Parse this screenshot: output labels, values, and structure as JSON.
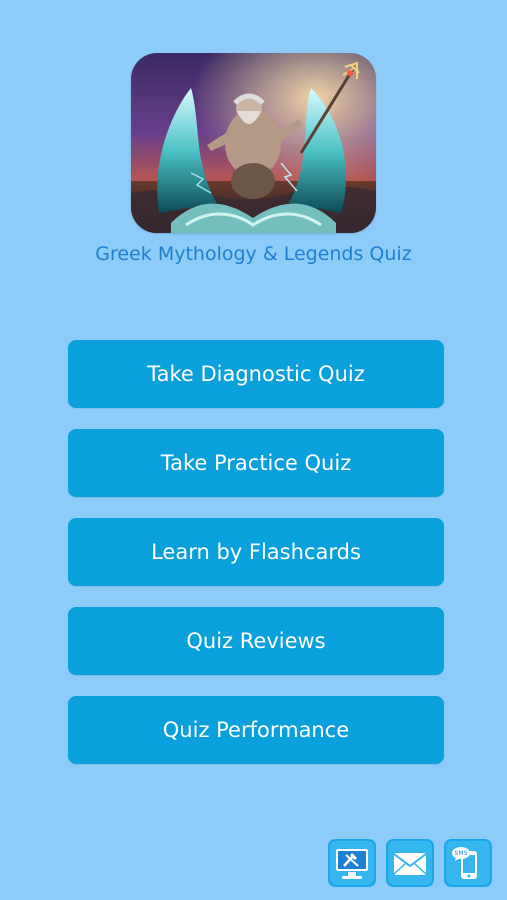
{
  "app": {
    "title": "Greek Mythology & Legends Quiz"
  },
  "menu": {
    "items": [
      {
        "label": "Take Diagnostic Quiz"
      },
      {
        "label": "Take Practice Quiz"
      },
      {
        "label": "Learn by Flashcards"
      },
      {
        "label": "Quiz Reviews"
      },
      {
        "label": "Quiz Performance"
      }
    ]
  },
  "bottom_bar": {
    "icons": [
      {
        "name": "desktop-tools-icon"
      },
      {
        "name": "mail-icon"
      },
      {
        "name": "sms-icon",
        "label": "SMS"
      }
    ]
  },
  "colors": {
    "background": "#8dcbf8",
    "title_text": "#1f7fd0",
    "button": "#0aa0dc",
    "button_text": "#ffffff"
  }
}
